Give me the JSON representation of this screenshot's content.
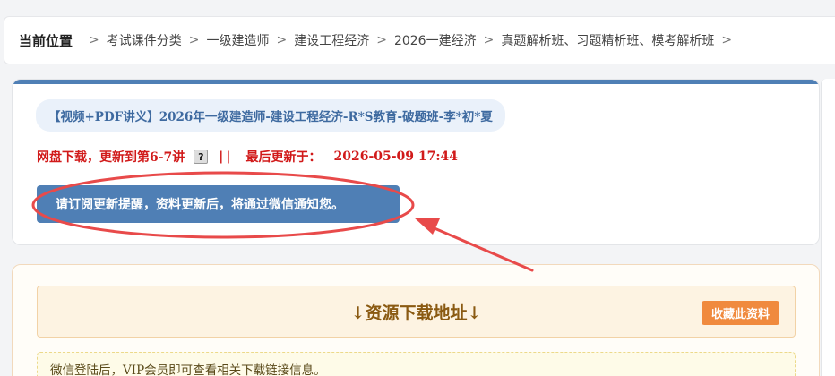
{
  "breadcrumb": {
    "title": "当前位置",
    "items": [
      "考试课件分类",
      "一级建造师",
      "建设工程经济",
      "2026一建经济",
      "真题解析班、习题精析班、模考解析班"
    ],
    "separator": ">"
  },
  "resource": {
    "title": "【视频+PDF讲义】2026年一级建造师-建设工程经济-R*S教育-破题班-李*初*夏",
    "update_text": "网盘下载，更新到第6-7讲",
    "help_icon": "?",
    "divider": "||",
    "last_update_label": "最后更新于：",
    "last_update_value": "2026-05-09 17:44",
    "subscribe_label": "请订阅更新提醒，资料更新后，将通过微信通知您。"
  },
  "download": {
    "title": "↓资源下载地址↓",
    "favorite_label": "收藏此资料",
    "note": "微信登陆后，VIP会员即可查看相关下载链接信息。"
  },
  "colors": {
    "accent_blue": "#4f7fb5",
    "alert_red": "#d11a1a",
    "annotation_red": "#e84a4a",
    "favorite_orange": "#f08a3e"
  }
}
